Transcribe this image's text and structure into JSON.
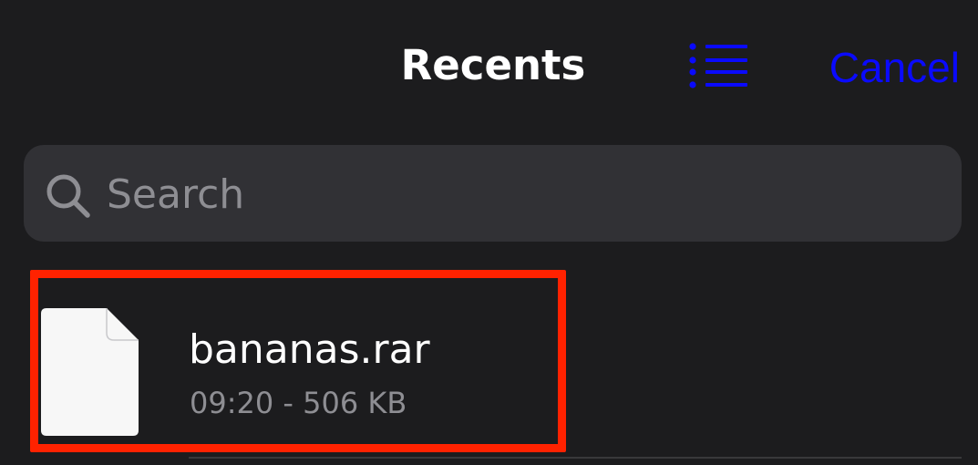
{
  "header": {
    "title": "Recents",
    "view_toggle_icon": "list-icon",
    "cancel_label": "Cancel"
  },
  "search": {
    "icon": "search-icon",
    "placeholder": "Search"
  },
  "files": [
    {
      "name": "bananas.rar",
      "meta": "09:20 - 506 KB",
      "icon": "document-icon"
    }
  ],
  "colors": {
    "background": "#1c1c1e",
    "search_field": "#313135",
    "accent": "#0a0aff",
    "highlight": "#ff2200",
    "secondary_text": "#8e8e93"
  }
}
